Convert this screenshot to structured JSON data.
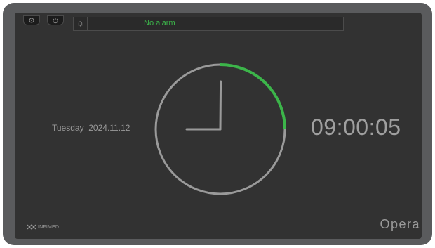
{
  "header": {
    "buttons": [
      {
        "icon": "gear-icon"
      },
      {
        "icon": "power-icon"
      }
    ],
    "alarm_bar": {
      "icon": "bell-icon",
      "text": "No alarm",
      "color": "#3cb54a"
    }
  },
  "main": {
    "date_label": "Tuesday  2024.11.12",
    "time_label": "09:00:05",
    "clock": {
      "hour": 9,
      "minute": 0,
      "second": 5,
      "progress_fraction": 0.25,
      "accent": "#3cb54a",
      "ring_color": "#9a9a9a"
    }
  },
  "footer": {
    "logo_text": "INFIMED",
    "brand": "Opera"
  }
}
